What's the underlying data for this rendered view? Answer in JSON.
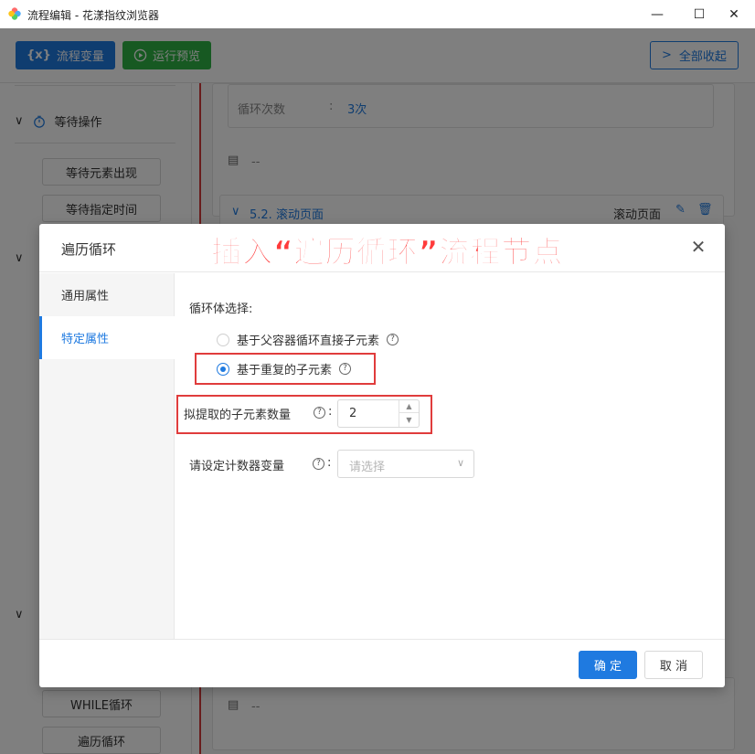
{
  "window": {
    "title": "流程编辑 - 花漾指纹浏览器",
    "minimize": "—",
    "maximize": "☐",
    "close": "✕"
  },
  "toolbar": {
    "vars_label": "流程变量",
    "vars_icon": "{x}",
    "preview_label": "运行预览",
    "collapse_label": "全部收起"
  },
  "sidebar": {
    "group_wait": "等待操作",
    "btn_wait_element": "等待元素出现",
    "btn_wait_time": "等待指定时间",
    "btn_while": "WHILE循环",
    "btn_traverse": "遍历循环"
  },
  "canvas": {
    "loop_count_label": "循环次数",
    "loop_count_sep": ":",
    "loop_count_value": "3次",
    "comment_placeholder": "--",
    "step_title": "5.2. 滚动页面",
    "step_type": "滚动页面",
    "comment_placeholder_2": "--"
  },
  "dialog": {
    "title": "遍历循环",
    "banner": "插入“遍历循环”流程节点",
    "nav": [
      "通用属性",
      "特定属性"
    ],
    "loop_body_label": "循环体选择:",
    "radio_option_1": "基于父容器循环直接子元素",
    "radio_option_2": "基于重复的子元素",
    "radio_selected": 2,
    "child_count_label": "拟提取的子元素数量",
    "child_count_value": "2",
    "counter_label": "请设定计数器变量",
    "counter_placeholder": "请选择",
    "colon": ":",
    "ok_label": "确 定",
    "cancel_label": "取 消"
  },
  "colors": {
    "primary": "#1f7ae0",
    "success": "#2fb344",
    "highlight": "#e03c3c"
  }
}
